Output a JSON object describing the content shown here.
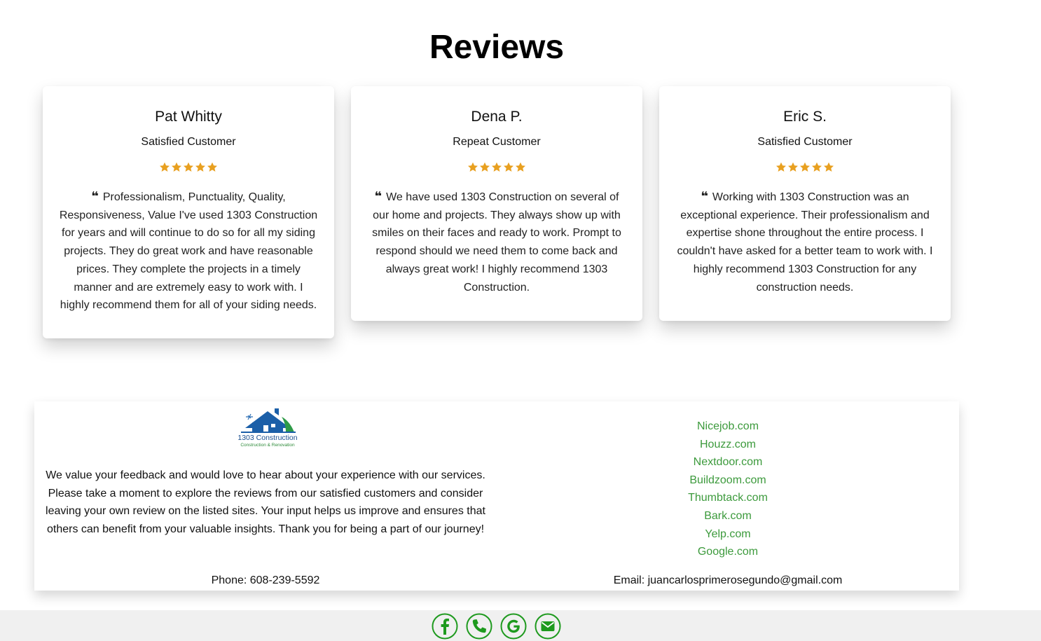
{
  "page": {
    "title": "Reviews"
  },
  "colors": {
    "star": "#E8A020",
    "link": "#3C9A3C",
    "footer_bg": "#F0F0F0",
    "social": "#1E9A1E"
  },
  "reviews": [
    {
      "name": "Pat Whitty",
      "role": "Satisfied Customer",
      "rating": 5,
      "text": "Professionalism, Punctuality, Quality, Responsiveness, Value I've used 1303 Construction for years and will continue to do so for all my siding projects. They do great work and have reasonable prices. They complete the projects in a timely manner and are extremely easy to work with. I highly recommend them for all of your siding needs."
    },
    {
      "name": "Dena P.",
      "role": "Repeat Customer",
      "rating": 5,
      "text": "We have used 1303 Construction on several of our home and projects. They always show up with smiles on their faces and ready to work. Prompt to respond should we need them to come back and always great work! I highly recommend 1303 Construction."
    },
    {
      "name": "Eric S.",
      "role": "Satisfied Customer",
      "rating": 5,
      "text": "Working with 1303 Construction was an exceptional experience. Their professionalism and expertise shone throughout the entire process. I couldn't have asked for a better team to work with. I highly recommend 1303 Construction for any construction needs."
    }
  ],
  "info": {
    "logo": {
      "name": "1303 Construction",
      "tagline": "Construction & Renovation"
    },
    "feedback": "We value your feedback and would love to hear about your experience with our services. Please take a moment to explore the reviews from our satisfied customers and consider leaving your own review on the listed sites. Your input helps us improve and ensures that others can benefit from your valuable insights. Thank you for being a part of our journey!",
    "phone": "Phone: 608-239-5592",
    "email": "Email: juancarlosprimerosegundo@gmail.com",
    "sites": [
      "Nicejob.com",
      "Houzz.com",
      "Nextdoor.com",
      "Buildzoom.com",
      "Thumbtack.com",
      "Bark.com",
      "Yelp.com",
      "Google.com"
    ]
  },
  "footer": {
    "social_icons": [
      "facebook-icon",
      "phone-icon",
      "google-icon",
      "email-icon"
    ]
  }
}
